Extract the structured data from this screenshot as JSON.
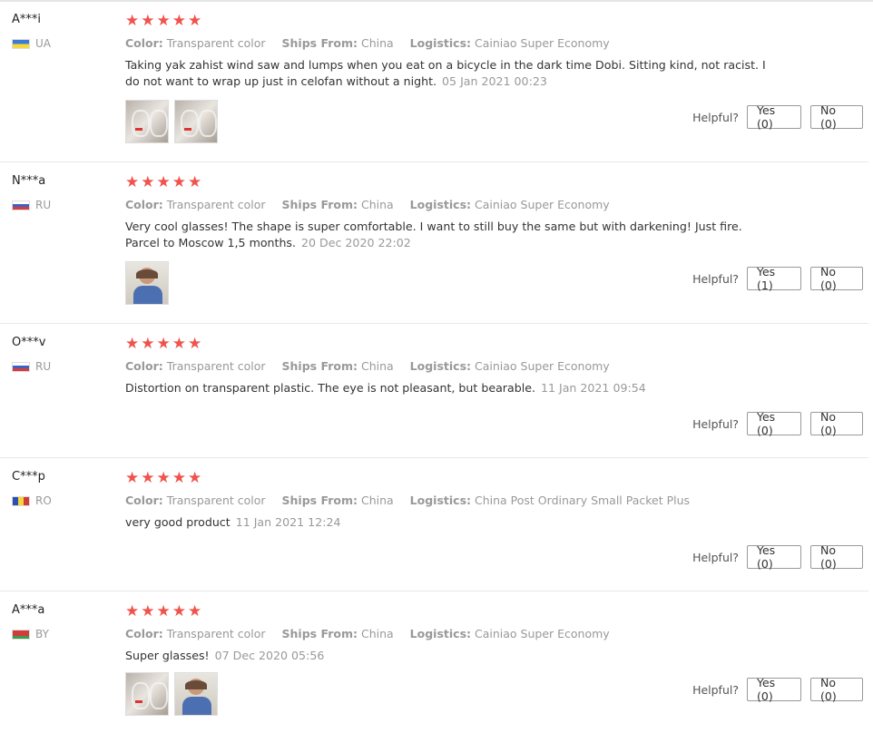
{
  "labels": {
    "color": "Color:",
    "ships_from": "Ships From:",
    "logistics": "Logistics:",
    "helpful": "Helpful?"
  },
  "reviews": [
    {
      "user": "A***i",
      "country": "UA",
      "flag_colors": [
        "#3a7bd5",
        "#f7d83b"
      ],
      "rating": 5,
      "color": "Transparent color",
      "ships_from": "China",
      "logistics": "Cainiao Super Economy",
      "text": "Taking yak zahist wind saw and lumps when you eat on a bicycle in the dark time Dobi. Sitting kind, not racist. I do not want to wrap up just in celofan without a night.",
      "date": "05 Jan 2021 00:23",
      "photos": [
        "glasses-photo",
        "glasses-photo"
      ],
      "yes": "Yes (0)",
      "no": "No (0)"
    },
    {
      "user": "N***a",
      "country": "RU",
      "flag_colors": [
        "#ffffff",
        "#3b62c4",
        "#d63c3c"
      ],
      "rating": 5,
      "color": "Transparent color",
      "ships_from": "China",
      "logistics": "Cainiao Super Economy",
      "text": "Very cool glasses! The shape is super comfortable. I want to still buy the same but with darkening! Just fire. Parcel to Moscow 1,5 months.",
      "date": "20 Dec 2020 22:02",
      "photos": [
        "person-photo"
      ],
      "yes": "Yes (1)",
      "no": "No (0)"
    },
    {
      "user": "O***v",
      "country": "RU",
      "flag_colors": [
        "#ffffff",
        "#3b62c4",
        "#d63c3c"
      ],
      "rating": 5,
      "color": "Transparent color",
      "ships_from": "China",
      "logistics": "Cainiao Super Economy",
      "text": "Distortion on transparent plastic. The eye is not pleasant, but bearable.",
      "date": "11 Jan 2021 09:54",
      "photos": [],
      "yes": "Yes (0)",
      "no": "No (0)"
    },
    {
      "user": "C***p",
      "country": "RO",
      "flag_colors": [
        "#2b4fb3",
        "#f5d63a",
        "#d33b3b"
      ],
      "rating": 5,
      "color": "Transparent color",
      "ships_from": "China",
      "logistics": "China Post Ordinary Small Packet Plus",
      "text": "very good product",
      "date": "11 Jan 2021 12:24",
      "photos": [],
      "yes": "Yes (0)",
      "no": "No (0)"
    },
    {
      "user": "A***a",
      "country": "BY",
      "flag_colors": [
        "#d13b3b",
        "#3f9a4a"
      ],
      "rating": 5,
      "color": "Transparent color",
      "ships_from": "China",
      "logistics": "Cainiao Super Economy",
      "text": "Super glasses!",
      "date": "07 Dec 2020 05:56",
      "photos": [
        "glasses-photo",
        "person-photo"
      ],
      "yes": "Yes (0)",
      "no": "No (0)"
    }
  ]
}
